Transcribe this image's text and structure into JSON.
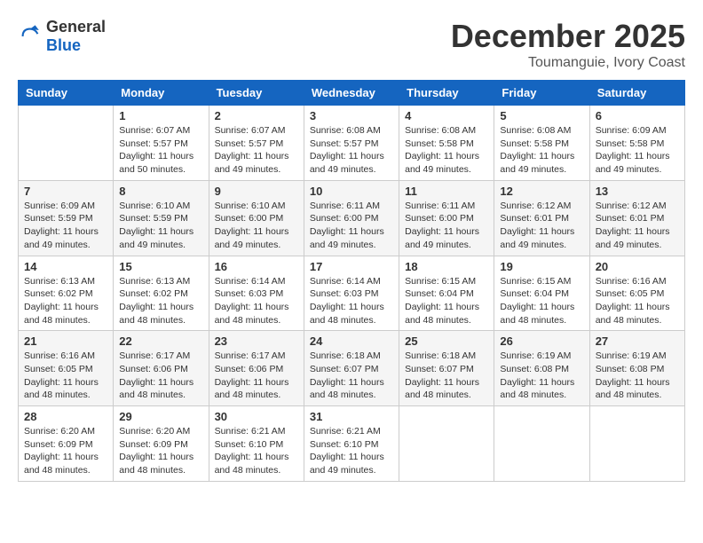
{
  "logo": {
    "general": "General",
    "blue": "Blue"
  },
  "title": {
    "month": "December 2025",
    "location": "Toumanguie, Ivory Coast"
  },
  "days_of_week": [
    "Sunday",
    "Monday",
    "Tuesday",
    "Wednesday",
    "Thursday",
    "Friday",
    "Saturday"
  ],
  "weeks": [
    [
      {
        "day": "",
        "sunrise": "",
        "sunset": "",
        "daylight": ""
      },
      {
        "day": "1",
        "sunrise": "Sunrise: 6:07 AM",
        "sunset": "Sunset: 5:57 PM",
        "daylight": "Daylight: 11 hours and 50 minutes."
      },
      {
        "day": "2",
        "sunrise": "Sunrise: 6:07 AM",
        "sunset": "Sunset: 5:57 PM",
        "daylight": "Daylight: 11 hours and 49 minutes."
      },
      {
        "day": "3",
        "sunrise": "Sunrise: 6:08 AM",
        "sunset": "Sunset: 5:57 PM",
        "daylight": "Daylight: 11 hours and 49 minutes."
      },
      {
        "day": "4",
        "sunrise": "Sunrise: 6:08 AM",
        "sunset": "Sunset: 5:58 PM",
        "daylight": "Daylight: 11 hours and 49 minutes."
      },
      {
        "day": "5",
        "sunrise": "Sunrise: 6:08 AM",
        "sunset": "Sunset: 5:58 PM",
        "daylight": "Daylight: 11 hours and 49 minutes."
      },
      {
        "day": "6",
        "sunrise": "Sunrise: 6:09 AM",
        "sunset": "Sunset: 5:58 PM",
        "daylight": "Daylight: 11 hours and 49 minutes."
      }
    ],
    [
      {
        "day": "7",
        "sunrise": "Sunrise: 6:09 AM",
        "sunset": "Sunset: 5:59 PM",
        "daylight": "Daylight: 11 hours and 49 minutes."
      },
      {
        "day": "8",
        "sunrise": "Sunrise: 6:10 AM",
        "sunset": "Sunset: 5:59 PM",
        "daylight": "Daylight: 11 hours and 49 minutes."
      },
      {
        "day": "9",
        "sunrise": "Sunrise: 6:10 AM",
        "sunset": "Sunset: 6:00 PM",
        "daylight": "Daylight: 11 hours and 49 minutes."
      },
      {
        "day": "10",
        "sunrise": "Sunrise: 6:11 AM",
        "sunset": "Sunset: 6:00 PM",
        "daylight": "Daylight: 11 hours and 49 minutes."
      },
      {
        "day": "11",
        "sunrise": "Sunrise: 6:11 AM",
        "sunset": "Sunset: 6:00 PM",
        "daylight": "Daylight: 11 hours and 49 minutes."
      },
      {
        "day": "12",
        "sunrise": "Sunrise: 6:12 AM",
        "sunset": "Sunset: 6:01 PM",
        "daylight": "Daylight: 11 hours and 49 minutes."
      },
      {
        "day": "13",
        "sunrise": "Sunrise: 6:12 AM",
        "sunset": "Sunset: 6:01 PM",
        "daylight": "Daylight: 11 hours and 49 minutes."
      }
    ],
    [
      {
        "day": "14",
        "sunrise": "Sunrise: 6:13 AM",
        "sunset": "Sunset: 6:02 PM",
        "daylight": "Daylight: 11 hours and 48 minutes."
      },
      {
        "day": "15",
        "sunrise": "Sunrise: 6:13 AM",
        "sunset": "Sunset: 6:02 PM",
        "daylight": "Daylight: 11 hours and 48 minutes."
      },
      {
        "day": "16",
        "sunrise": "Sunrise: 6:14 AM",
        "sunset": "Sunset: 6:03 PM",
        "daylight": "Daylight: 11 hours and 48 minutes."
      },
      {
        "day": "17",
        "sunrise": "Sunrise: 6:14 AM",
        "sunset": "Sunset: 6:03 PM",
        "daylight": "Daylight: 11 hours and 48 minutes."
      },
      {
        "day": "18",
        "sunrise": "Sunrise: 6:15 AM",
        "sunset": "Sunset: 6:04 PM",
        "daylight": "Daylight: 11 hours and 48 minutes."
      },
      {
        "day": "19",
        "sunrise": "Sunrise: 6:15 AM",
        "sunset": "Sunset: 6:04 PM",
        "daylight": "Daylight: 11 hours and 48 minutes."
      },
      {
        "day": "20",
        "sunrise": "Sunrise: 6:16 AM",
        "sunset": "Sunset: 6:05 PM",
        "daylight": "Daylight: 11 hours and 48 minutes."
      }
    ],
    [
      {
        "day": "21",
        "sunrise": "Sunrise: 6:16 AM",
        "sunset": "Sunset: 6:05 PM",
        "daylight": "Daylight: 11 hours and 48 minutes."
      },
      {
        "day": "22",
        "sunrise": "Sunrise: 6:17 AM",
        "sunset": "Sunset: 6:06 PM",
        "daylight": "Daylight: 11 hours and 48 minutes."
      },
      {
        "day": "23",
        "sunrise": "Sunrise: 6:17 AM",
        "sunset": "Sunset: 6:06 PM",
        "daylight": "Daylight: 11 hours and 48 minutes."
      },
      {
        "day": "24",
        "sunrise": "Sunrise: 6:18 AM",
        "sunset": "Sunset: 6:07 PM",
        "daylight": "Daylight: 11 hours and 48 minutes."
      },
      {
        "day": "25",
        "sunrise": "Sunrise: 6:18 AM",
        "sunset": "Sunset: 6:07 PM",
        "daylight": "Daylight: 11 hours and 48 minutes."
      },
      {
        "day": "26",
        "sunrise": "Sunrise: 6:19 AM",
        "sunset": "Sunset: 6:08 PM",
        "daylight": "Daylight: 11 hours and 48 minutes."
      },
      {
        "day": "27",
        "sunrise": "Sunrise: 6:19 AM",
        "sunset": "Sunset: 6:08 PM",
        "daylight": "Daylight: 11 hours and 48 minutes."
      }
    ],
    [
      {
        "day": "28",
        "sunrise": "Sunrise: 6:20 AM",
        "sunset": "Sunset: 6:09 PM",
        "daylight": "Daylight: 11 hours and 48 minutes."
      },
      {
        "day": "29",
        "sunrise": "Sunrise: 6:20 AM",
        "sunset": "Sunset: 6:09 PM",
        "daylight": "Daylight: 11 hours and 48 minutes."
      },
      {
        "day": "30",
        "sunrise": "Sunrise: 6:21 AM",
        "sunset": "Sunset: 6:10 PM",
        "daylight": "Daylight: 11 hours and 48 minutes."
      },
      {
        "day": "31",
        "sunrise": "Sunrise: 6:21 AM",
        "sunset": "Sunset: 6:10 PM",
        "daylight": "Daylight: 11 hours and 49 minutes."
      },
      {
        "day": "",
        "sunrise": "",
        "sunset": "",
        "daylight": ""
      },
      {
        "day": "",
        "sunrise": "",
        "sunset": "",
        "daylight": ""
      },
      {
        "day": "",
        "sunrise": "",
        "sunset": "",
        "daylight": ""
      }
    ]
  ]
}
